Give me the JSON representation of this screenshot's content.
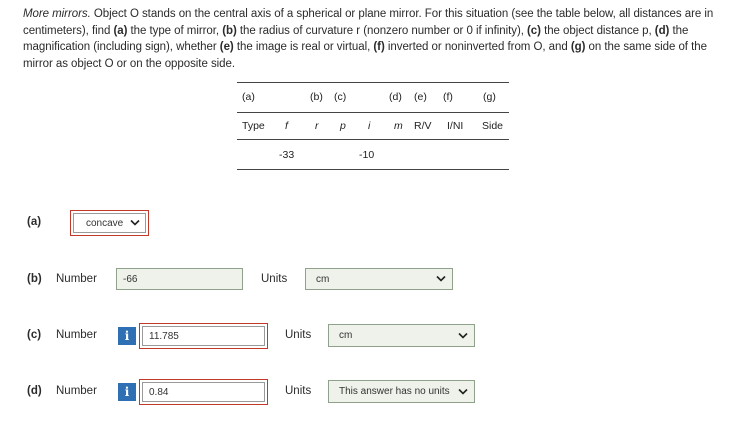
{
  "problem": {
    "title": "More mirrors.",
    "s1": " Object O stands on the central axis of a spherical or plane mirror. For this situation (see the table below, all distances are in centimeters), find ",
    "a_tag": "(a)",
    "a_text": " the type of mirror, ",
    "b_tag": "(b)",
    "b_text": " the radius of curvature r (nonzero number or 0 if infinity), ",
    "c_tag": "(c)",
    "c_text": " the object distance p, ",
    "d_tag": "(d)",
    "d_text": " the magnification (including sign), whether ",
    "e_tag": "(e)",
    "e_text": " the image is real or virtual, ",
    "f_tag": "(f)",
    "f_text": " inverted or noninverted from O, and ",
    "g_tag": "(g)",
    "g_text": " on the same side of the mirror as object O or on the opposite side."
  },
  "table": {
    "header_row1": [
      "(a)",
      "(b)",
      "(c)",
      "(d)",
      "(e)",
      "(f)",
      "(g)"
    ],
    "header_row2": [
      "Type",
      "f",
      "r",
      "p",
      "i",
      "m",
      "R/V",
      "I/NI",
      "Side"
    ],
    "values": {
      "f": "-33",
      "i": "-10"
    }
  },
  "answers": {
    "a": {
      "label": "(a)",
      "select_value": "concave"
    },
    "b": {
      "label": "(b)",
      "number_label": "Number",
      "value": "-66",
      "units_label": "Units",
      "units_value": "cm"
    },
    "c": {
      "label": "(c)",
      "number_label": "Number",
      "info_icon": "i",
      "value": "11.785",
      "units_label": "Units",
      "units_value": "cm"
    },
    "d": {
      "label": "(d)",
      "number_label": "Number",
      "info_icon": "i",
      "value": "0.84",
      "units_label": "Units",
      "units_value": "This answer has no units"
    }
  }
}
